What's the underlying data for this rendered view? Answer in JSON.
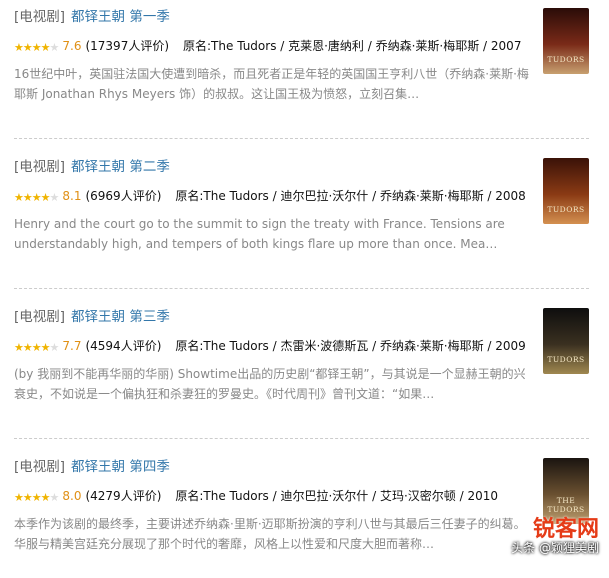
{
  "results": [
    {
      "category": "[电视剧]",
      "title": "都铎王朝 第一季",
      "rating_value": 3.8,
      "rating": "7.6",
      "votes": "(17397人评价)",
      "meta": "原名:The Tudors / 克莱恩·唐纳利 / 乔纳森·莱斯·梅耶斯 / 2007",
      "description": "16世纪中叶，英国驻法国大使遭到暗杀，而且死者正是年轻的英国国王亨利八世（乔纳森·莱斯·梅耶斯 Jonathan Rhys Meyers 饰）的叔叔。这让国王极为愤怒，立刻召集…",
      "poster_text": "TUDORS",
      "poster_colors": [
        "#2a0c08",
        "#7a2a18",
        "#c8a070"
      ]
    },
    {
      "category": "[电视剧]",
      "title": "都铎王朝 第二季",
      "rating_value": 4.05,
      "rating": "8.1",
      "votes": "(6969人评价)",
      "meta": "原名:The Tudors / 迪尔巴拉·沃尔什 / 乔纳森·莱斯·梅耶斯 / 2008",
      "description": "Henry and the court go to the summit to sign the treaty with France. Tensions are understandably high, and tempers of both kings flare up more than once. Mea…",
      "poster_text": "TUDORS",
      "poster_colors": [
        "#3a1208",
        "#8a3a14",
        "#d49050"
      ]
    },
    {
      "category": "[电视剧]",
      "title": "都铎王朝 第三季",
      "rating_value": 3.85,
      "rating": "7.7",
      "votes": "(4594人评价)",
      "meta": "原名:The Tudors / 杰雷米·波德斯瓦 / 乔纳森·莱斯·梅耶斯 / 2009",
      "description": "(by 我丽到不能再华丽的华丽) Showtime出品的历史剧“都铎王朝”，与其说是一个显赫王朝的兴衰史，不如说是一个偏执狂和杀妻狂的罗曼史。《时代周刊》曾刊文道：“如果…",
      "poster_text": "TUDORS",
      "poster_colors": [
        "#0e0e0e",
        "#3a3020",
        "#a08850"
      ]
    },
    {
      "category": "[电视剧]",
      "title": "都铎王朝 第四季",
      "rating_value": 4.0,
      "rating": "8.0",
      "votes": "(4279人评价)",
      "meta": "原名:The Tudors / 迪尔巴拉·沃尔什 / 艾玛·汉密尔顿 / 2010",
      "description": "本季作为该剧的最终季，主要讲述乔纳森·里斯·迈耶斯扮演的亨利八世与其最后三任妻子的纠葛。华服与精美宫廷充分展现了那个时代的奢靡，风格上以性爱和尺度大胆而著称…",
      "poster_text": "THE TUDORS",
      "poster_colors": [
        "#1a1410",
        "#6a5030",
        "#c0a070"
      ]
    }
  ],
  "watermark": {
    "brand": "锐客网",
    "handle": "头条 @颖狸美剧"
  }
}
